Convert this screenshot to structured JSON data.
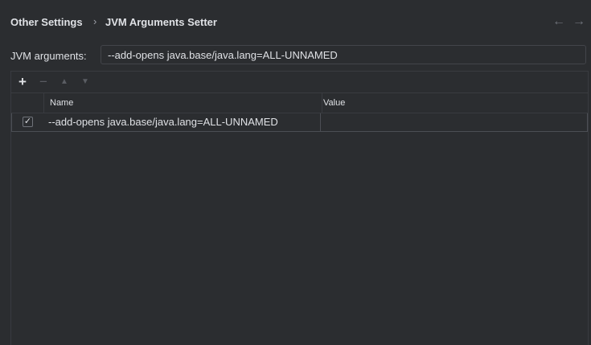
{
  "breadcrumb": {
    "parent": "Other Settings",
    "separator": "›",
    "current": "JVM Arguments Setter"
  },
  "nav": {
    "back_icon": "←",
    "forward_icon": "→"
  },
  "jvm_args": {
    "label": "JVM arguments:",
    "value": "--add-opens java.base/java.lang=ALL-UNNAMED"
  },
  "toolbar": {
    "add_icon": "+",
    "remove_icon": "−",
    "move_up_icon": "▲",
    "move_down_icon": "▼"
  },
  "table": {
    "columns": [
      "",
      "Name",
      "Value"
    ],
    "rows": [
      {
        "checked": true,
        "check_glyph": "✓",
        "name": "--add-opens java.base/java.lang=ALL-UNNAMED",
        "value": ""
      }
    ]
  }
}
